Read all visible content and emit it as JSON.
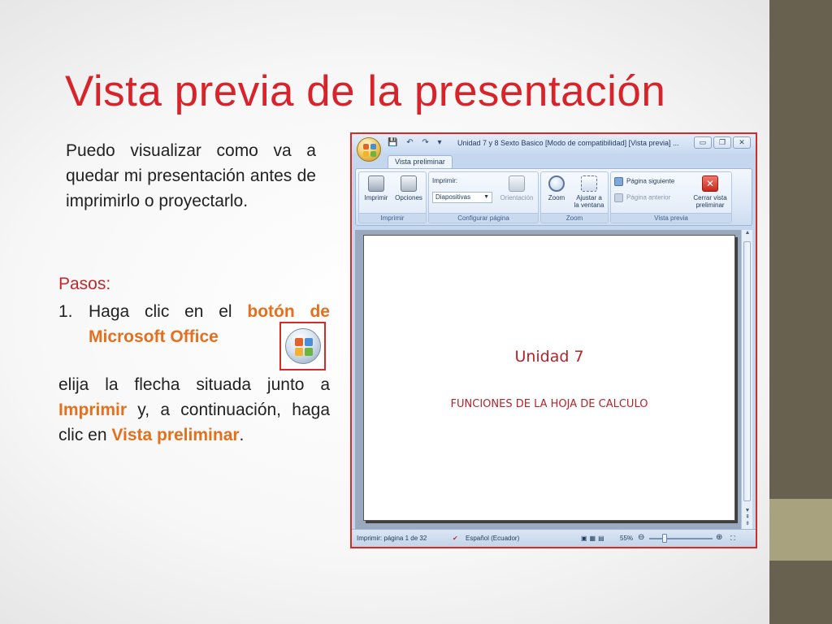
{
  "slide": {
    "title": "Vista previa de la presentación",
    "intro": "Puedo visualizar como va a quedar mi presentación antes de imprimirlo o proyectarlo.",
    "steps_label": "Pasos:",
    "step1": {
      "number": "1.",
      "text_before": "Haga clic en el ",
      "highlight": "botón de Microsoft Office"
    },
    "para2": {
      "t1": "elija la flecha situada junto a ",
      "h1": "Imprimir",
      "t2": " y, a continuación, haga clic en ",
      "h2": "Vista preliminar",
      "t3": "."
    },
    "colors": {
      "title": "#d9232a",
      "highlight": "#e4701e",
      "band_dark": "#686150",
      "band_light": "#a9a27f"
    },
    "office_button_icon": "office-orb-icon"
  },
  "window": {
    "title": "Unidad 7 y 8 Sexto Basico [Modo de compatibilidad] [Vista previa] ...",
    "quick_access": "💾 ↶ ↷ ▾",
    "controls": {
      "minimize": "▭",
      "restore": "❐",
      "close": "✕"
    },
    "tab": "Vista preliminar",
    "ribbon": {
      "imprimir_group": {
        "name": "Imprimir",
        "print": "Imprimir",
        "options": "Opciones"
      },
      "config_group": {
        "name": "Configurar página",
        "print_label": "Imprimir:",
        "print_value": "Diapositivas",
        "orientation": "Orientación"
      },
      "zoom_group": {
        "name": "Zoom",
        "zoom": "Zoom",
        "fit_line1": "Ajustar a",
        "fit_line2": "la ventana"
      },
      "preview_group": {
        "name": "Vista previa",
        "next": "Página siguiente",
        "prev": "Página anterior",
        "close_line1": "Cerrar vista",
        "close_line2": "preliminar"
      }
    },
    "page": {
      "title": "Unidad 7",
      "subtitle": "FUNCIONES DE LA HOJA DE CALCULO"
    },
    "statusbar": {
      "page_info": "Imprimir: página 1 de 32",
      "language": "Español (Ecuador)",
      "zoom": "55%",
      "minus": "⊖",
      "plus": "⊕"
    }
  }
}
